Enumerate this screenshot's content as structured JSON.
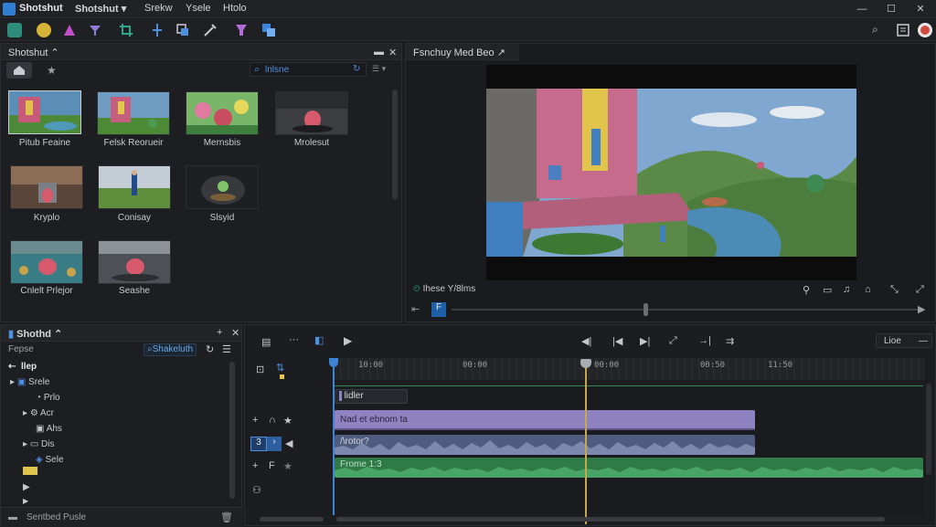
{
  "titlebar": {
    "app_name": "Shotshut",
    "menus": [
      "Shotshut",
      "Srekw",
      "Ysele",
      "Htolo"
    ],
    "dropdown_glyph": "▾"
  },
  "media_panel": {
    "title": "Shotshut",
    "search_placeholder": "lnlsne",
    "items": [
      {
        "label": "Pitub Feaine"
      },
      {
        "label": "Felsk Reorueir"
      },
      {
        "label": "Mernsbis"
      },
      {
        "label": "Mrolesut"
      },
      {
        "label": "Kryplo"
      },
      {
        "label": "Conisay"
      },
      {
        "label": "Slsyid"
      },
      {
        "label": "Cnlelt Prlejor"
      },
      {
        "label": "Seashe"
      }
    ]
  },
  "preview_panel": {
    "title": "Fsnchuy Med Beo",
    "timecode": "Ihese Y/8lms"
  },
  "project_panel": {
    "title": "Shothd",
    "filter_label": "Fepse",
    "search_button": "Shakeluth",
    "tree": [
      {
        "label": "llep",
        "level": 0
      },
      {
        "label": "Srele",
        "level": 1
      },
      {
        "label": "Prlo",
        "level": 2
      },
      {
        "label": "Acr",
        "level": 2
      },
      {
        "label": "Ahs",
        "level": 2
      },
      {
        "label": "Dis",
        "level": 2
      },
      {
        "label": "Sele",
        "level": 2
      }
    ],
    "footer": "Sentbed Pusle"
  },
  "timeline": {
    "zoom_label": "Lioe",
    "ruler": [
      "10:00",
      "00:00",
      "00:00",
      "00:50",
      "11:50"
    ],
    "tracks": [
      {
        "label": "lidler",
        "kind": "title"
      },
      {
        "label": "Nad et ebnom ta",
        "kind": "video"
      },
      {
        "label": "/\\rotor?",
        "kind": "audio"
      },
      {
        "label": "Frome 1:3",
        "kind": "audio2"
      }
    ],
    "track_number": "3"
  },
  "colors": {
    "accent": "#2f7fd2",
    "clip_purple": "#8f82c0",
    "clip_audio": "#4f5b7f",
    "clip_green": "#2f7a46",
    "playhead": "#c9a84a"
  }
}
